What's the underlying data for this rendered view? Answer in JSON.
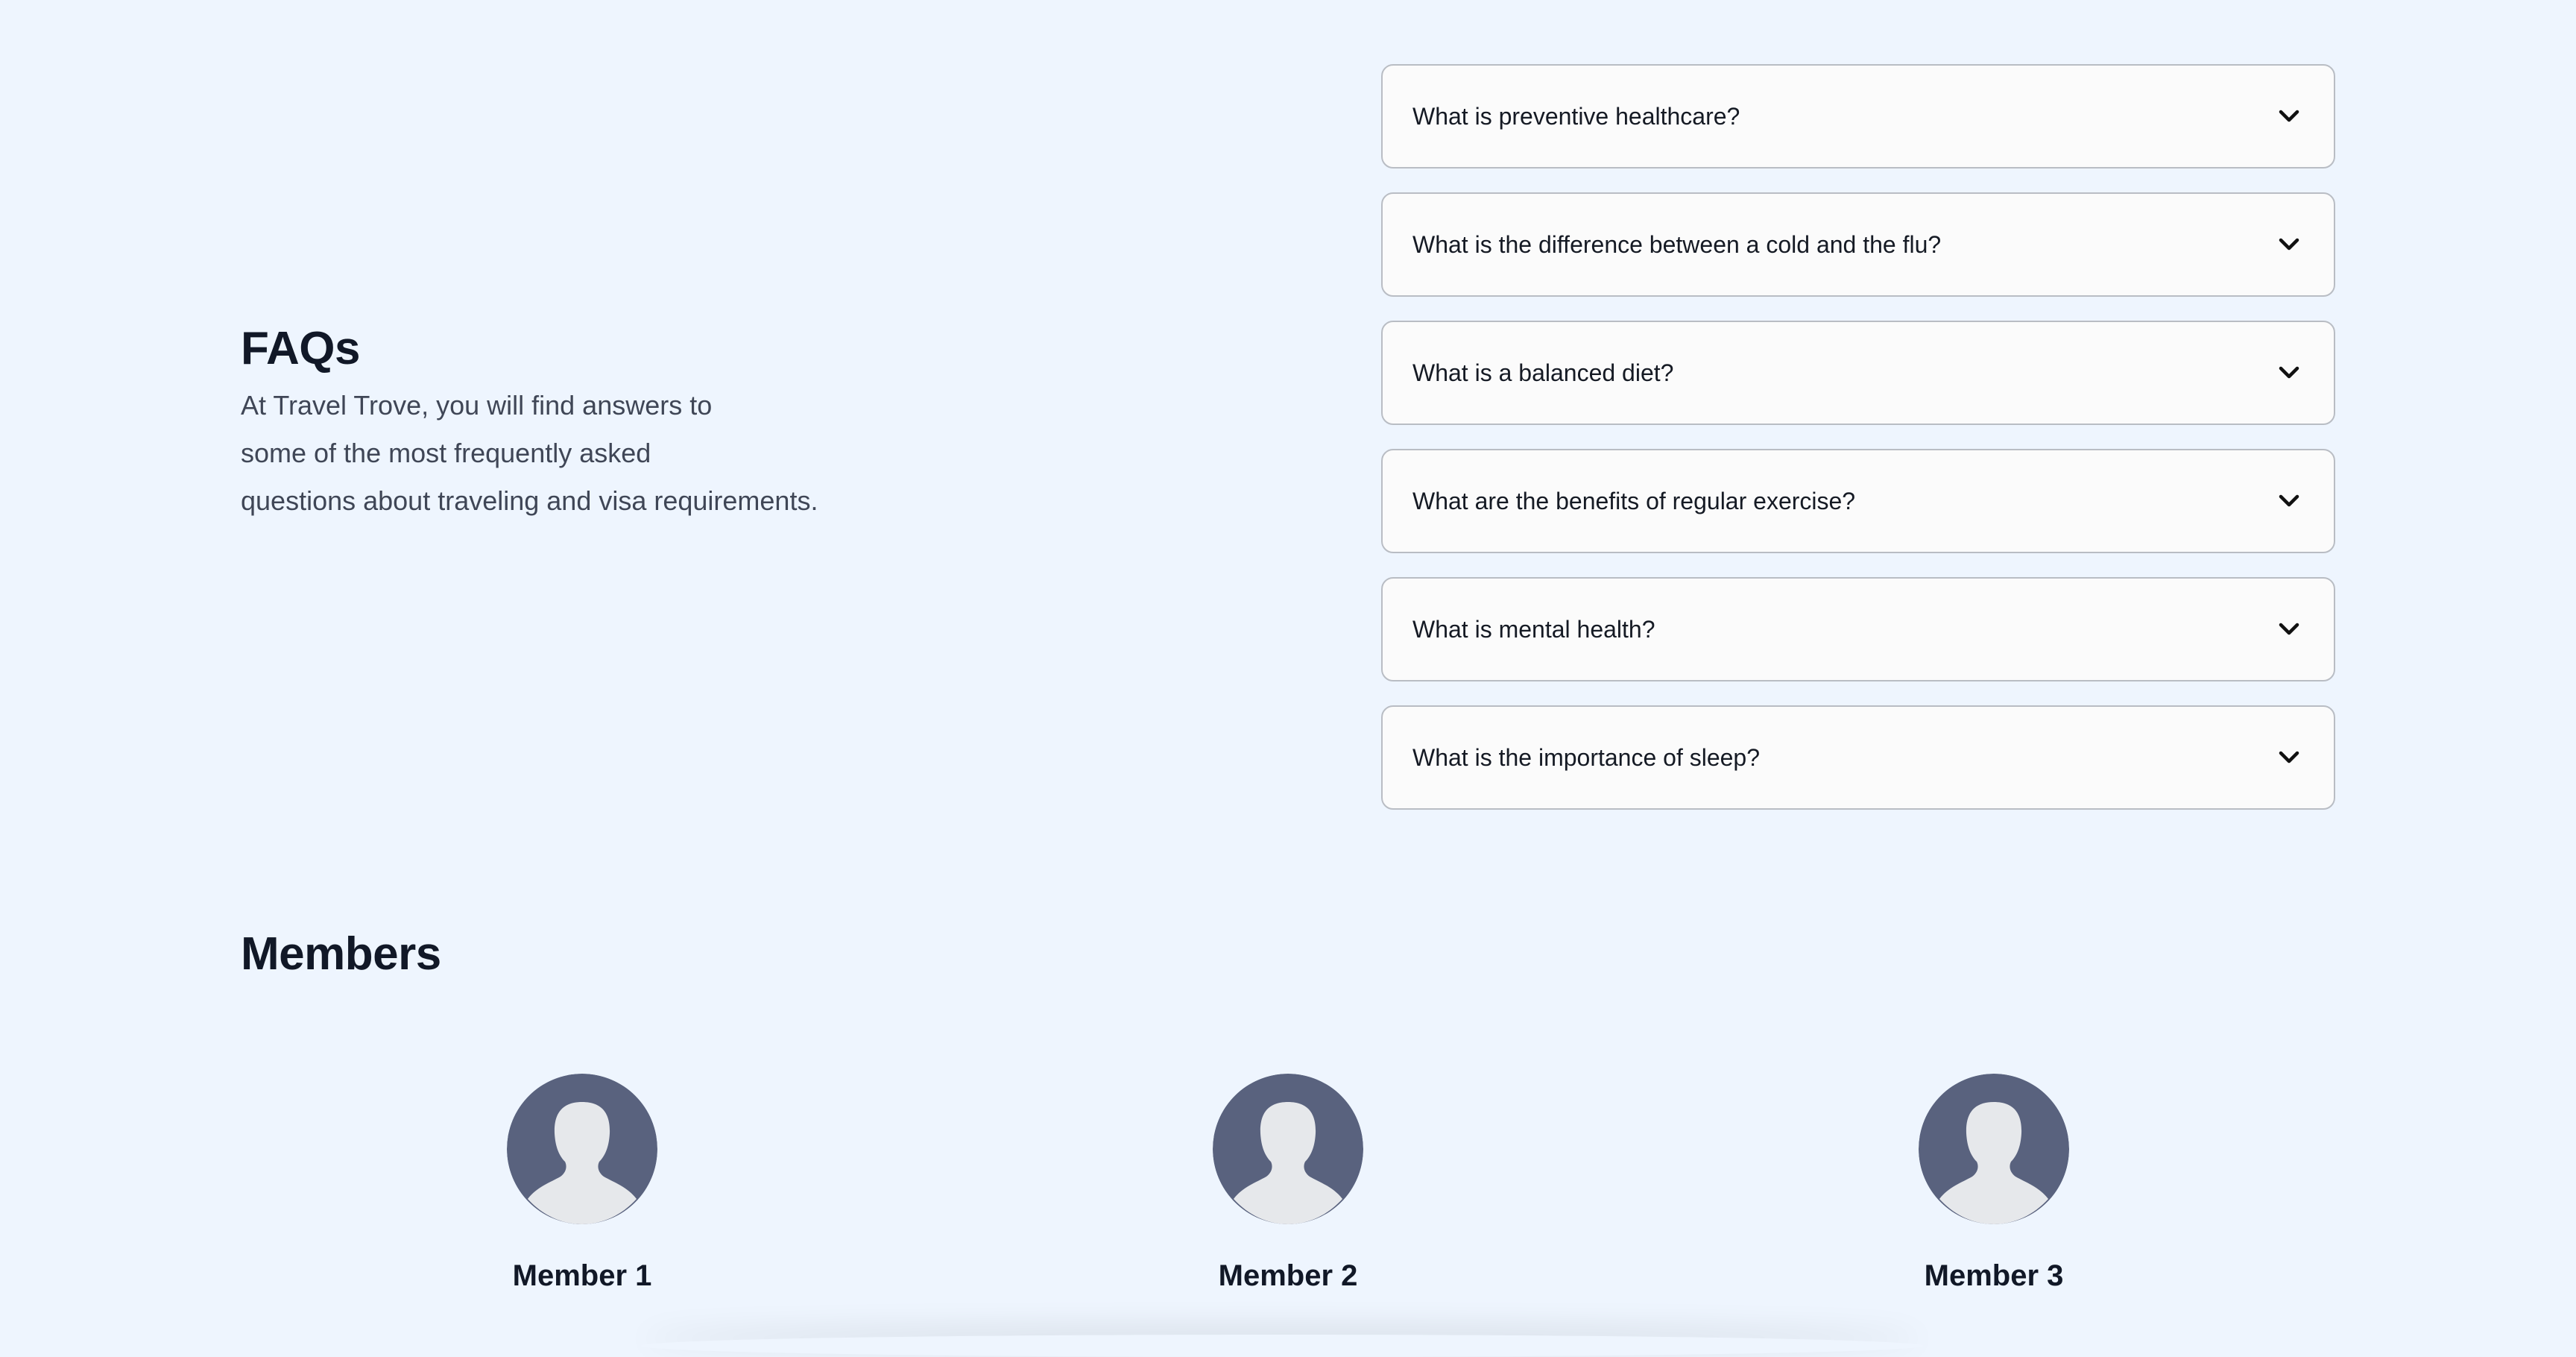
{
  "faq": {
    "title": "FAQs",
    "description_lines": [
      "At Travel Trove, you will find answers to",
      "some of the most frequently asked",
      "questions about traveling and visa requirements."
    ],
    "questions": [
      "What is preventive healthcare?",
      "What is the difference between a cold and the flu?",
      "What is a balanced diet?",
      "What are the benefits of regular exercise?",
      "What is mental health?",
      "What is the importance of sleep?"
    ],
    "chevron_icon": "chevron-down-icon"
  },
  "members": {
    "title": "Members",
    "avatar_icon": "user-avatar-icon",
    "items": [
      {
        "name": "Member 1"
      },
      {
        "name": "Member 2"
      },
      {
        "name": "Member 3"
      }
    ]
  },
  "colors": {
    "background": "#eef5fe",
    "avatar_bg": "#59627e",
    "avatar_silhouette": "#e6e8eb",
    "card_border": "#b9bdc4"
  }
}
